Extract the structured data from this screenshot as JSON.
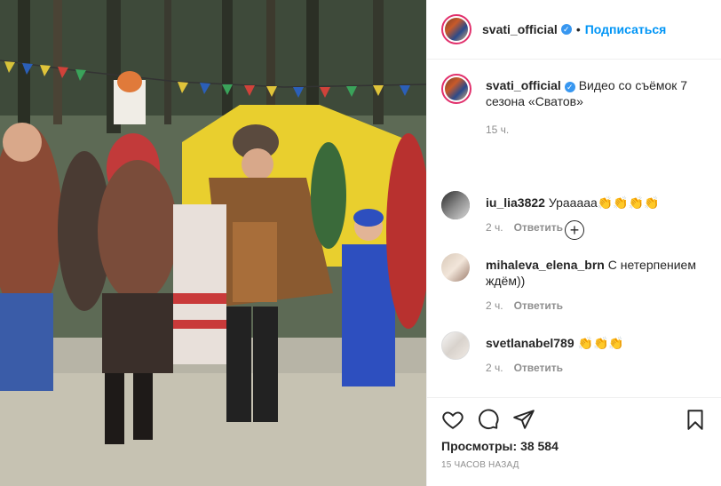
{
  "colors": {
    "accent": "#0095f6",
    "verified": "#3897f0",
    "muted": "#8e8e8e",
    "text": "#262626"
  },
  "media": {
    "type": "video",
    "icon": "video-frame"
  },
  "header": {
    "username": "svati_official",
    "separator": "•",
    "follow_label": "Подписаться"
  },
  "caption": {
    "username": "svati_official",
    "text": "Видео со съёмок 7 сезона «Сватов»",
    "time": "15 ч."
  },
  "comments": [
    {
      "username": "iu_lia3822",
      "text": "Урааааа👏👏👏👏",
      "time": "2 ч.",
      "reply": "Ответить"
    },
    {
      "username": "mihaleva_elena_brn",
      "text": "С нетерпением ждём))",
      "time": "2 ч.",
      "reply": "Ответить"
    },
    {
      "username": "svetlanabel789",
      "text": "👏👏👏",
      "time": "2 ч.",
      "reply": "Ответить"
    }
  ],
  "footer": {
    "views_label": "Просмотры:",
    "views_count": "38 584",
    "posted": "15 часов назад"
  },
  "icons": {
    "like": "heart-icon",
    "comment": "comment-icon",
    "share": "share-icon",
    "save": "bookmark-icon",
    "load_more": "plus-circle-icon"
  }
}
